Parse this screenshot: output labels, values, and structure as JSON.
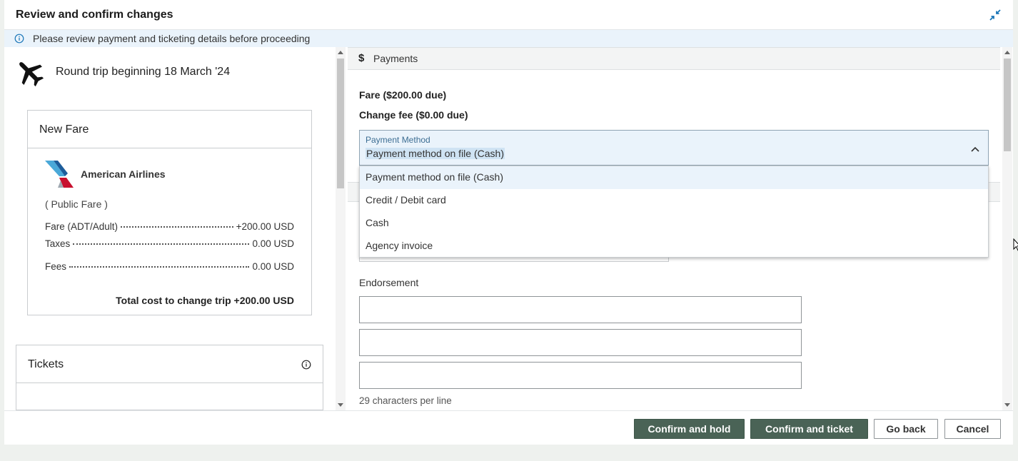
{
  "dialog": {
    "title": "Review and confirm changes",
    "info_message": "Please review payment and ticketing details before proceeding"
  },
  "trip": {
    "title": "Round trip beginning 18 March '24"
  },
  "new_fare": {
    "heading": "New Fare",
    "airline": "American Airlines",
    "fare_type": "( Public Fare )",
    "rows": [
      {
        "label": "Fare (ADT/Adult)",
        "amount": "+200.00 USD"
      },
      {
        "label": "Taxes",
        "amount": "0.00 USD"
      },
      {
        "label": "Fees",
        "amount": "0.00 USD"
      }
    ],
    "total": "Total cost to change trip +200.00 USD"
  },
  "tickets": {
    "heading": "Tickets"
  },
  "payments": {
    "heading": "Payments",
    "fare_due": "Fare ($200.00 due)",
    "change_fee_due": "Change fee ($0.00 due)",
    "method_label": "Payment Method",
    "method_value": "Payment method on file (Cash)",
    "options": [
      "Payment method on file (Cash)",
      "Credit / Debit card",
      "Cash",
      "Agency invoice"
    ],
    "endorsement_label": "Endorsement",
    "endorsement_hint": "29 characters per line"
  },
  "footer": {
    "confirm_hold": "Confirm and hold",
    "confirm_ticket": "Confirm and ticket",
    "go_back": "Go back",
    "cancel": "Cancel"
  },
  "colors": {
    "primary_button": "#4a6356",
    "info_bar": "#eaf3fb",
    "accent_blue": "#1a76b8"
  }
}
